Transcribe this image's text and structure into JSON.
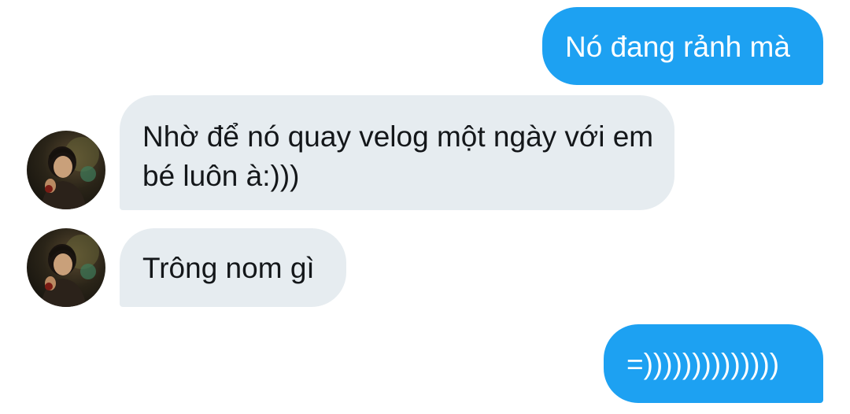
{
  "conversation": {
    "messages": [
      {
        "direction": "outgoing",
        "text": "Nó đang rảnh mà"
      },
      {
        "direction": "incoming",
        "text": "Nhờ để nó quay velog một ngày với em bé luôn à:)))"
      },
      {
        "direction": "incoming",
        "text": "Trông nom gì"
      },
      {
        "direction": "outgoing",
        "text": "=))))))))))))))"
      }
    ]
  },
  "colors": {
    "outgoing_bubble": "#1da1f2",
    "incoming_bubble": "#e6ecf0",
    "outgoing_text": "#ffffff",
    "incoming_text": "#14171a"
  },
  "icons": {
    "avatar": "user-avatar-photo"
  }
}
